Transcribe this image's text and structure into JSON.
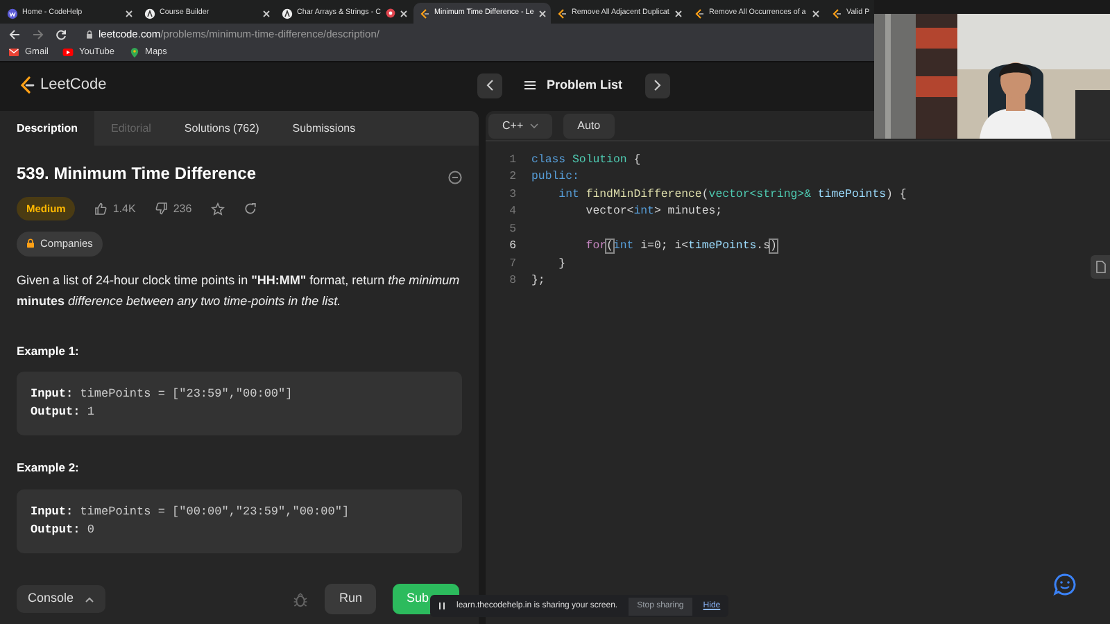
{
  "browser": {
    "tabs": [
      {
        "title": "Home - CodeHelp",
        "kind": "codehelp",
        "selected": false,
        "recording": false,
        "closable": true
      },
      {
        "title": "Course Builder",
        "kind": "circle",
        "selected": false,
        "recording": false,
        "closable": true
      },
      {
        "title": "Char Arrays & Strings - C",
        "kind": "circle",
        "selected": false,
        "recording": true,
        "closable": true
      },
      {
        "title": "Minimum Time Difference - Le",
        "kind": "leetcode",
        "selected": true,
        "recording": false,
        "closable": true
      },
      {
        "title": "Remove All Adjacent Duplicat",
        "kind": "leetcode",
        "selected": false,
        "recording": false,
        "closable": true
      },
      {
        "title": "Remove All Occurrences of a",
        "kind": "leetcode",
        "selected": false,
        "recording": false,
        "closable": true
      },
      {
        "title": "Valid P",
        "kind": "leetcode",
        "selected": false,
        "recording": false,
        "closable": false
      }
    ],
    "url": {
      "host": "leetcode.com",
      "path": "/problems/minimum-time-difference/description/"
    },
    "bookmarks": [
      {
        "label": "Gmail",
        "kind": "gmail"
      },
      {
        "label": "YouTube",
        "kind": "youtube"
      },
      {
        "label": "Maps",
        "kind": "maps"
      }
    ]
  },
  "header": {
    "logo": "LeetCode",
    "title": "Problem List"
  },
  "problem_tabs": [
    {
      "label": "Description",
      "selected": true,
      "disabled": false
    },
    {
      "label": "Editorial",
      "selected": false,
      "disabled": true
    },
    {
      "label": "Solutions (762)",
      "selected": false,
      "disabled": false
    },
    {
      "label": "Submissions",
      "selected": false,
      "disabled": false
    }
  ],
  "problem": {
    "title": "539. Minimum Time Difference",
    "difficulty": "Medium",
    "likes": "1.4K",
    "dislikes": "236",
    "companies": "Companies",
    "description": "Given a list of 24-hour clock time points in **\"HH:MM\"** format, return *the minimum* **minutes** *difference between any two time-points in the list.*",
    "examples": [
      {
        "heading": "Example 1:",
        "lines": [
          {
            "label": "Input:",
            "value": "timePoints = [\"23:59\",\"00:00\"]"
          },
          {
            "label": "Output:",
            "value": "1"
          }
        ]
      },
      {
        "heading": "Example 2:",
        "lines": [
          {
            "label": "Input:",
            "value": "timePoints = [\"00:00\",\"23:59\",\"00:00\"]"
          },
          {
            "label": "Output:",
            "value": "0"
          }
        ]
      }
    ]
  },
  "bottom_bar": {
    "console": "Console",
    "run": "Run",
    "submit": "Sub"
  },
  "editor": {
    "language": "C++",
    "mode": "Auto",
    "lines": [
      {
        "number": "1",
        "active": false,
        "tokens": [
          {
            "kind": "keyword",
            "text": "class"
          },
          {
            "kind": "type",
            "text": " Solution"
          },
          {
            "kind": "plain",
            "text": " {"
          }
        ]
      },
      {
        "number": "2",
        "active": false,
        "tokens": [
          {
            "kind": "keyword",
            "text": "public:"
          }
        ]
      },
      {
        "number": "3",
        "active": false,
        "tokens": [
          {
            "kind": "keyword",
            "text": "    int"
          },
          {
            "kind": "func",
            "text": " findMinDifference"
          },
          {
            "kind": "plain",
            "text": "("
          },
          {
            "kind": "type",
            "text": "vector<string>&"
          },
          {
            "kind": "param",
            "text": " timePoints"
          },
          {
            "kind": "plain",
            "text": ") {"
          }
        ]
      },
      {
        "number": "4",
        "active": false,
        "tokens": [
          {
            "kind": "plain",
            "text": "        vector<"
          },
          {
            "kind": "keyword",
            "text": "int"
          },
          {
            "kind": "plain",
            "text": "> minutes;"
          }
        ]
      },
      {
        "number": "5",
        "active": false
      },
      {
        "number": "6",
        "active": true,
        "tokens": [
          {
            "kind": "control",
            "text": "        for"
          },
          {
            "kind": "match",
            "text": "("
          },
          {
            "kind": "keyword",
            "text": "int"
          },
          {
            "kind": "plain",
            "text": " i=0; i<"
          },
          {
            "kind": "param",
            "text": "timePoints"
          },
          {
            "kind": "plain",
            "text": ".s"
          },
          {
            "kind": "match",
            "text": ")"
          }
        ]
      },
      {
        "number": "7",
        "active": false,
        "tokens": [
          {
            "kind": "plain",
            "text": "    }"
          }
        ]
      },
      {
        "number": "8",
        "active": false,
        "tokens": [
          {
            "kind": "plain",
            "text": "};"
          }
        ]
      }
    ]
  },
  "share_bar": {
    "text": "learn.thecodehelp.in is sharing your screen.",
    "stop": "Stop sharing",
    "hide": "Hide"
  }
}
